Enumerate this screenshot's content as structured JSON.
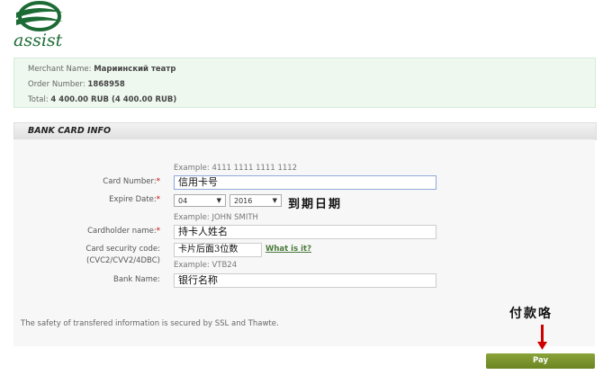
{
  "logo": {
    "text": "assist"
  },
  "order": {
    "merchant_label": "Merchant Name:",
    "merchant": "Мариинский театр",
    "order_label": "Order Number:",
    "order": "1868958",
    "total_label": "Total:",
    "total": "4 400.00 RUB (4 400.00 RUB)"
  },
  "section_title": "BANK CARD INFO",
  "form": {
    "card_example": "Example: 4111 1111 1111 1112",
    "card_label": "Card Number:",
    "card_value": "信用卡号",
    "expire_label": "Expire Date:",
    "expire_month": "04",
    "expire_year": "2016",
    "expire_note": "到期日期",
    "holder_example": "Example: JOHN SMITH",
    "holder_label": "Cardholder name:",
    "holder_value": "持卡人姓名",
    "cvc_label": "Card security code:",
    "cvc_label2": "(CVC2/CVV2/4DBC)",
    "cvc_value": "卡片后面3位数",
    "what_link": "What is it?",
    "bank_example": "Example: VTB24",
    "bank_label": "Bank Name:",
    "bank_value": "银行名称",
    "required_mark": "*"
  },
  "security_note": "The safety of transfered information is secured by SSL and Thawte.",
  "pay_note": "付款咯",
  "pay_button": "Pay",
  "colors": {
    "brand": "#1c6b35",
    "pay": "#7a932e",
    "arrow": "#d00000"
  }
}
